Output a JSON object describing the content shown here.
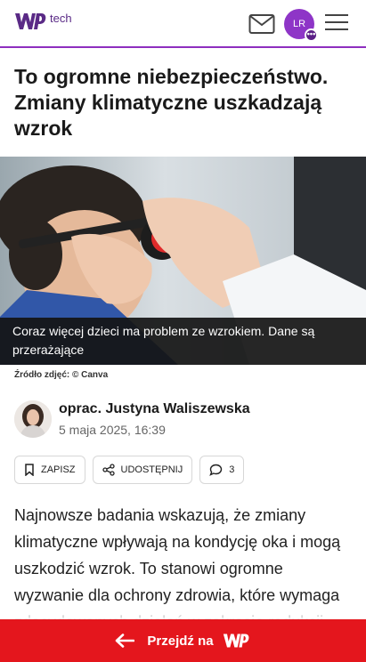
{
  "header": {
    "logo_icon": "wp-logo-icon",
    "logo_suffix": "tech",
    "mail_icon": "mail-icon",
    "avatar_initials": "LR",
    "avatar_badge": "•••",
    "menu_icon": "hamburger-menu-icon",
    "accent_color": "#8e2fbf"
  },
  "article": {
    "title": "To ogromne niebezpieczeństwo. Zmiany klimatyczne uszkadzają wzrok",
    "image_caption": "Coraz więcej dzieci ma problem ze wzrokiem. Dane są przerażające",
    "image_source": "Źródło zdjęć: © Canva",
    "author": "oprac. Justyna Waliszewska",
    "date": "5 maja 2025, 16:39",
    "body": "Najnowsze badania wskazują, że zmiany klimatyczne wpływają na kondycję oka i mogą uszkodzić wzrok. To stanowi ogromne wyzwanie dla ochrony zdrowia, które wymaga zdecydowanych działań w zakresie redukcji"
  },
  "actions": {
    "save_label": "ZAPISZ",
    "share_label": "UDOSTĘPNIJ",
    "comments_count": "3"
  },
  "bottom_bar": {
    "label": "Przejdź na",
    "color": "#e4161d"
  }
}
